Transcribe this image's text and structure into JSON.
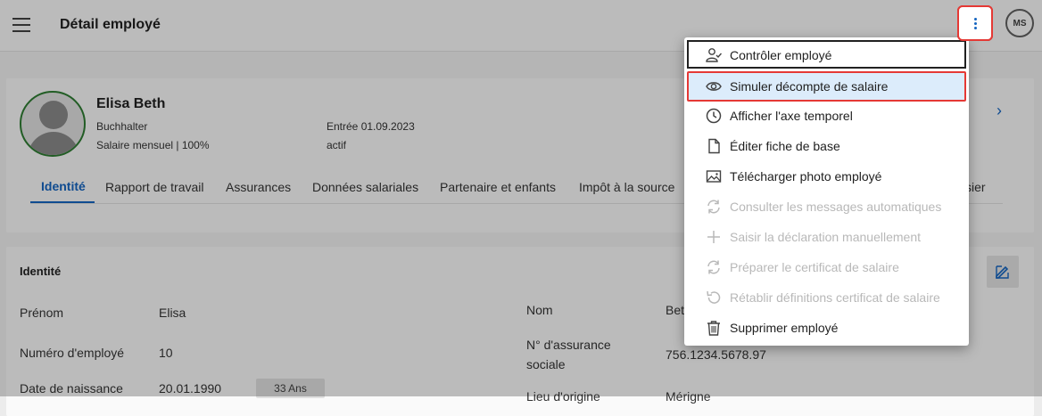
{
  "topbar": {
    "title": "Détail employé",
    "user_initials": "MS"
  },
  "employee": {
    "name": "Elisa Beth",
    "role": "Buchhalter",
    "salary": "Salaire mensuel | 100%",
    "entry": "Entrée 01.09.2023",
    "status": "actif"
  },
  "tabs": [
    {
      "label": "Identité"
    },
    {
      "label": "Rapport de travail"
    },
    {
      "label": "Assurances"
    },
    {
      "label": "Données salariales"
    },
    {
      "label": "Partenaire et enfants"
    },
    {
      "label": "Impôt à la source"
    },
    {
      "label": "sier"
    }
  ],
  "identity": {
    "section_title": "Identité",
    "fields_left": [
      {
        "label": "Prénom",
        "value": "Elisa"
      },
      {
        "label": "Numéro d'employé",
        "value": "10"
      },
      {
        "label": "Date de naissance",
        "value": "20.01.1990",
        "chip": "33 Ans"
      }
    ],
    "fields_right": [
      {
        "label": "Nom",
        "value": "Bet"
      },
      {
        "label_line1": "N° d'assurance",
        "label_line2": "sociale",
        "value": "756.1234.5678.97"
      },
      {
        "label": "Lieu d'origine",
        "value": "Mérigne"
      }
    ]
  },
  "menu": {
    "items": [
      {
        "label": "Contrôler employé",
        "icon": "person-check-icon",
        "disabled": false
      },
      {
        "label": "Simuler décompte de salaire",
        "icon": "eye-icon",
        "disabled": false
      },
      {
        "label": "Afficher l'axe temporel",
        "icon": "clock-icon",
        "disabled": false
      },
      {
        "label": "Éditer fiche de base",
        "icon": "document-icon",
        "disabled": false
      },
      {
        "label": "Télécharger photo employé",
        "icon": "image-icon",
        "disabled": false
      },
      {
        "label": "Consulter les messages automatiques",
        "icon": "sync-icon",
        "disabled": true
      },
      {
        "label": "Saisir la déclaration manuellement",
        "icon": "plus-icon",
        "disabled": true
      },
      {
        "label": "Préparer le certificat de salaire",
        "icon": "sync-icon",
        "disabled": true
      },
      {
        "label": "Rétablir définitions certificat de salaire",
        "icon": "undo-icon",
        "disabled": true
      },
      {
        "label": "Supprimer employé",
        "icon": "trash-icon",
        "disabled": false
      }
    ]
  }
}
